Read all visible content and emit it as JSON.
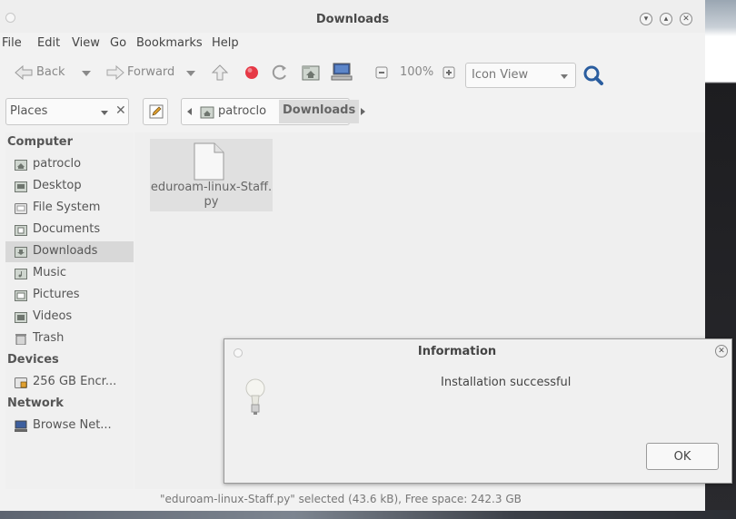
{
  "window": {
    "title": "Downloads"
  },
  "menubar": [
    "File",
    "Edit",
    "View",
    "Go",
    "Bookmarks",
    "Help"
  ],
  "toolbar": {
    "back_label": "Back",
    "forward_label": "Forward",
    "zoom_level": "100%",
    "view_mode": "Icon View"
  },
  "location": {
    "places_label": "Places",
    "crumbs": [
      "patroclo",
      "Downloads"
    ]
  },
  "sidebar": {
    "sections": [
      {
        "heading": "Computer",
        "items": [
          "patroclo",
          "Desktop",
          "File System",
          "Documents",
          "Downloads",
          "Music",
          "Pictures",
          "Videos",
          "Trash"
        ]
      },
      {
        "heading": "Devices",
        "items": [
          "256 GB Encr..."
        ]
      },
      {
        "heading": "Network",
        "items": [
          "Browse Net..."
        ]
      }
    ],
    "selected": "Downloads"
  },
  "files": [
    {
      "name_line1": "eduroam-linux-Staff.",
      "name_line2": "py"
    }
  ],
  "statusbar": {
    "text": "\"eduroam-linux-Staff.py\" selected (43.6 kB), Free space: 242.3 GB"
  },
  "dialog": {
    "title": "Information",
    "message": "Installation successful",
    "ok_label": "OK"
  },
  "icons": {
    "stop": "stop-icon",
    "search": "search-icon"
  },
  "colors": {
    "stop_red": "#e63946",
    "search_blue": "#2a5d9f"
  }
}
